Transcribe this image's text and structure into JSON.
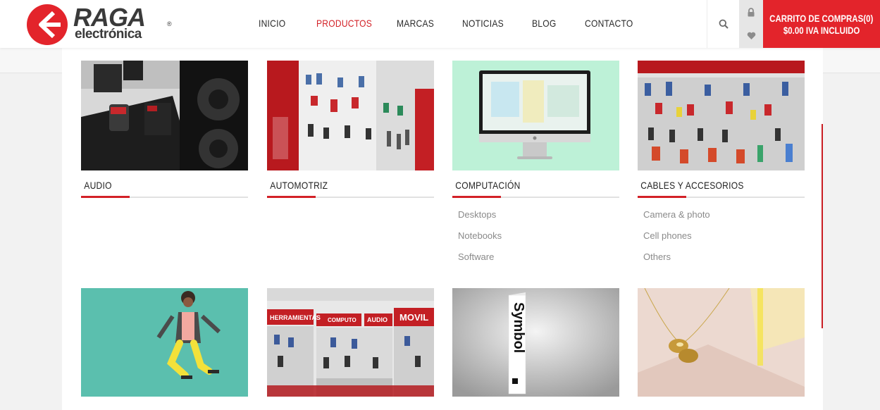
{
  "brand": {
    "name": "RAGA",
    "sub": "electrónica",
    "registered": "®"
  },
  "nav": {
    "items": [
      {
        "label": "INICIO",
        "active": false
      },
      {
        "label": "PRODUCTOS",
        "active": true
      },
      {
        "label": "MARCAS",
        "active": false
      },
      {
        "label": "NOTICIAS",
        "active": false
      },
      {
        "label": "BLOG",
        "active": false
      },
      {
        "label": "CONTACTO",
        "active": false
      }
    ]
  },
  "icons": {
    "search": "search-icon",
    "account": "lock-icon",
    "wishlist": "heart-icon"
  },
  "cart": {
    "label": "CARRITO DE COMPRAS",
    "count": "(0)",
    "total": "$0.00 IVA INCLUIDO"
  },
  "colors": {
    "accent": "#d32127",
    "cart_bg": "#e3242b"
  },
  "categories": [
    {
      "title": "AUDIO",
      "sub": []
    },
    {
      "title": "AUTOMOTRIZ",
      "sub": []
    },
    {
      "title": "COMPUTACIÓN",
      "sub": [
        "Desktops",
        "Notebooks",
        "Software"
      ]
    },
    {
      "title": "CABLES Y ACCESORIOS",
      "sub": [
        "Camera & photo",
        "Cell phones",
        "Others"
      ]
    }
  ],
  "bottom_images": {
    "book_text": "Symbol",
    "store_signs": [
      "HERRAMIENTAS",
      "COMPUTO",
      "AUDIO",
      "MOVIL"
    ]
  }
}
